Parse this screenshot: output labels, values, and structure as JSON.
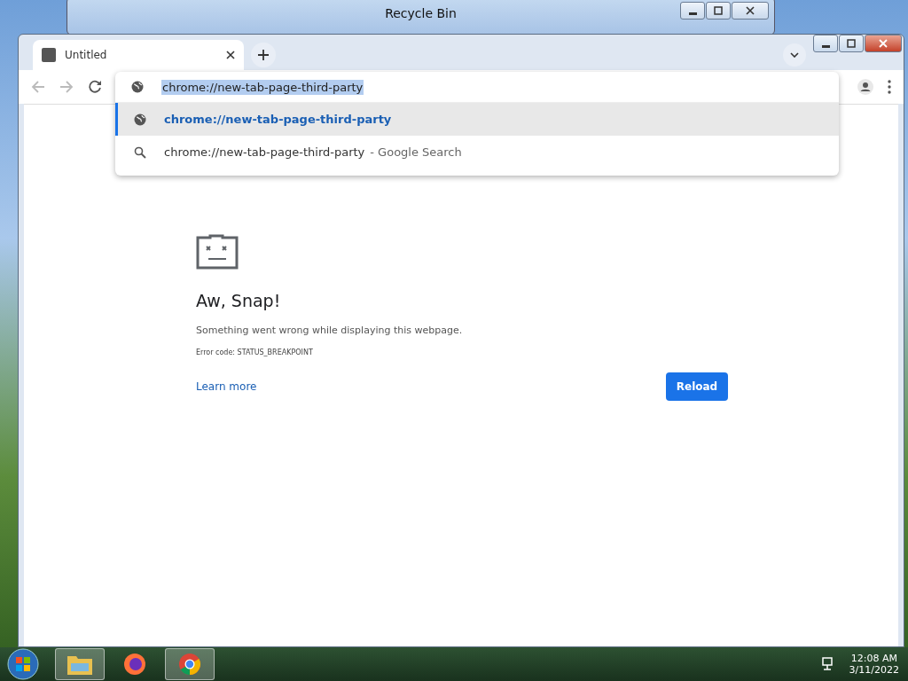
{
  "background_window": {
    "title": "Recycle Bin"
  },
  "browser": {
    "tabs": [
      {
        "title": "Untitled",
        "selected": true
      }
    ],
    "address": {
      "value": "chrome://new-tab-page-third-party",
      "text_selected": true
    },
    "suggestions": [
      {
        "kind": "url",
        "text": "chrome://new-tab-page-third-party",
        "selected": true
      },
      {
        "kind": "search",
        "text": "chrome://new-tab-page-third-party",
        "suffix": "- Google Search",
        "selected": false
      }
    ]
  },
  "error_page": {
    "heading": "Aw, Snap!",
    "message": "Something went wrong while displaying this webpage.",
    "error_code": "Error code: STATUS_BREAKPOINT",
    "link": "Learn more",
    "button": "Reload"
  },
  "taskbar": {
    "apps": [
      {
        "kind": "explorer",
        "running": true
      },
      {
        "kind": "firefox",
        "running": false
      },
      {
        "kind": "chrome",
        "running": true
      }
    ],
    "time": "12:08 AM",
    "date": "3/11/2022"
  }
}
